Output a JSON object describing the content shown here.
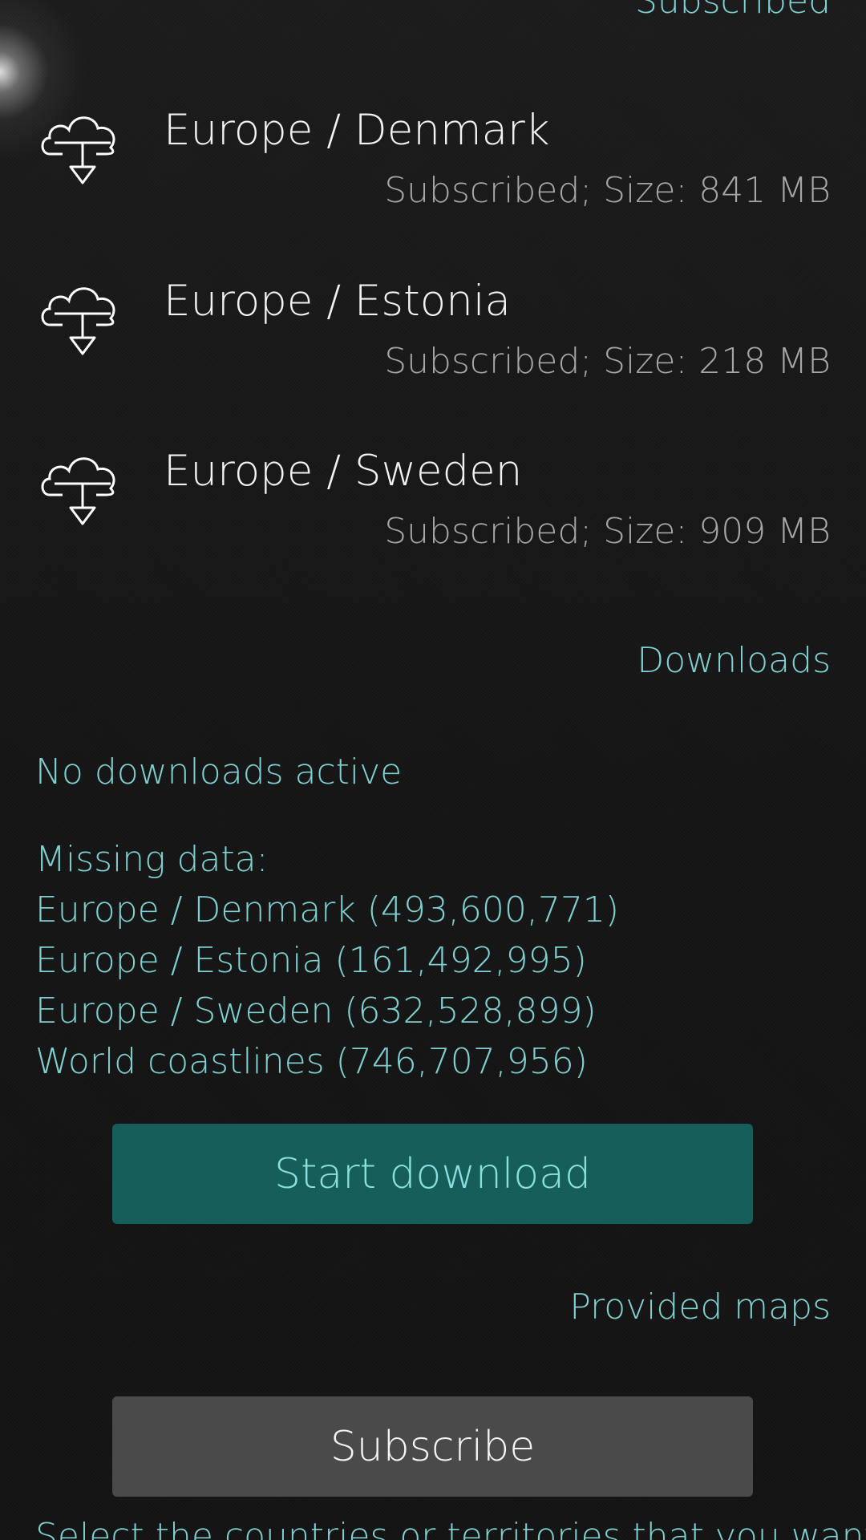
{
  "sections": {
    "subscribed": "Subscribed",
    "downloads": "Downloads",
    "provided_maps": "Provided maps"
  },
  "subscribed_maps": [
    {
      "name": "Europe / Denmark",
      "status": "Subscribed; Size: 841 MB",
      "icon": "cloud-download-icon"
    },
    {
      "name": "Europe / Estonia",
      "status": "Subscribed; Size: 218 MB",
      "icon": "cloud-download-icon"
    },
    {
      "name": "Europe / Sweden",
      "status": "Subscribed; Size: 909 MB",
      "icon": "cloud-download-icon"
    }
  ],
  "downloads": {
    "status": "No downloads active",
    "missing_title": "Missing data:",
    "missing": [
      "Europe / Denmark (493,600,771)",
      "Europe / Estonia (161,492,995)",
      "Europe / Sweden (632,528,899)",
      "World coastlines (746,707,956)"
    ],
    "start_button": "Start download"
  },
  "provided": {
    "subscribe_button": "Subscribe",
    "hint": "Select the countries or territories that you want"
  },
  "colors": {
    "accent": "#7fd1d1",
    "primary_text": "#f2f2f2",
    "secondary_text": "#a6a6a6",
    "start_button_bg": "#165e5a",
    "subscribe_button_bg": "#4a4a4a"
  }
}
